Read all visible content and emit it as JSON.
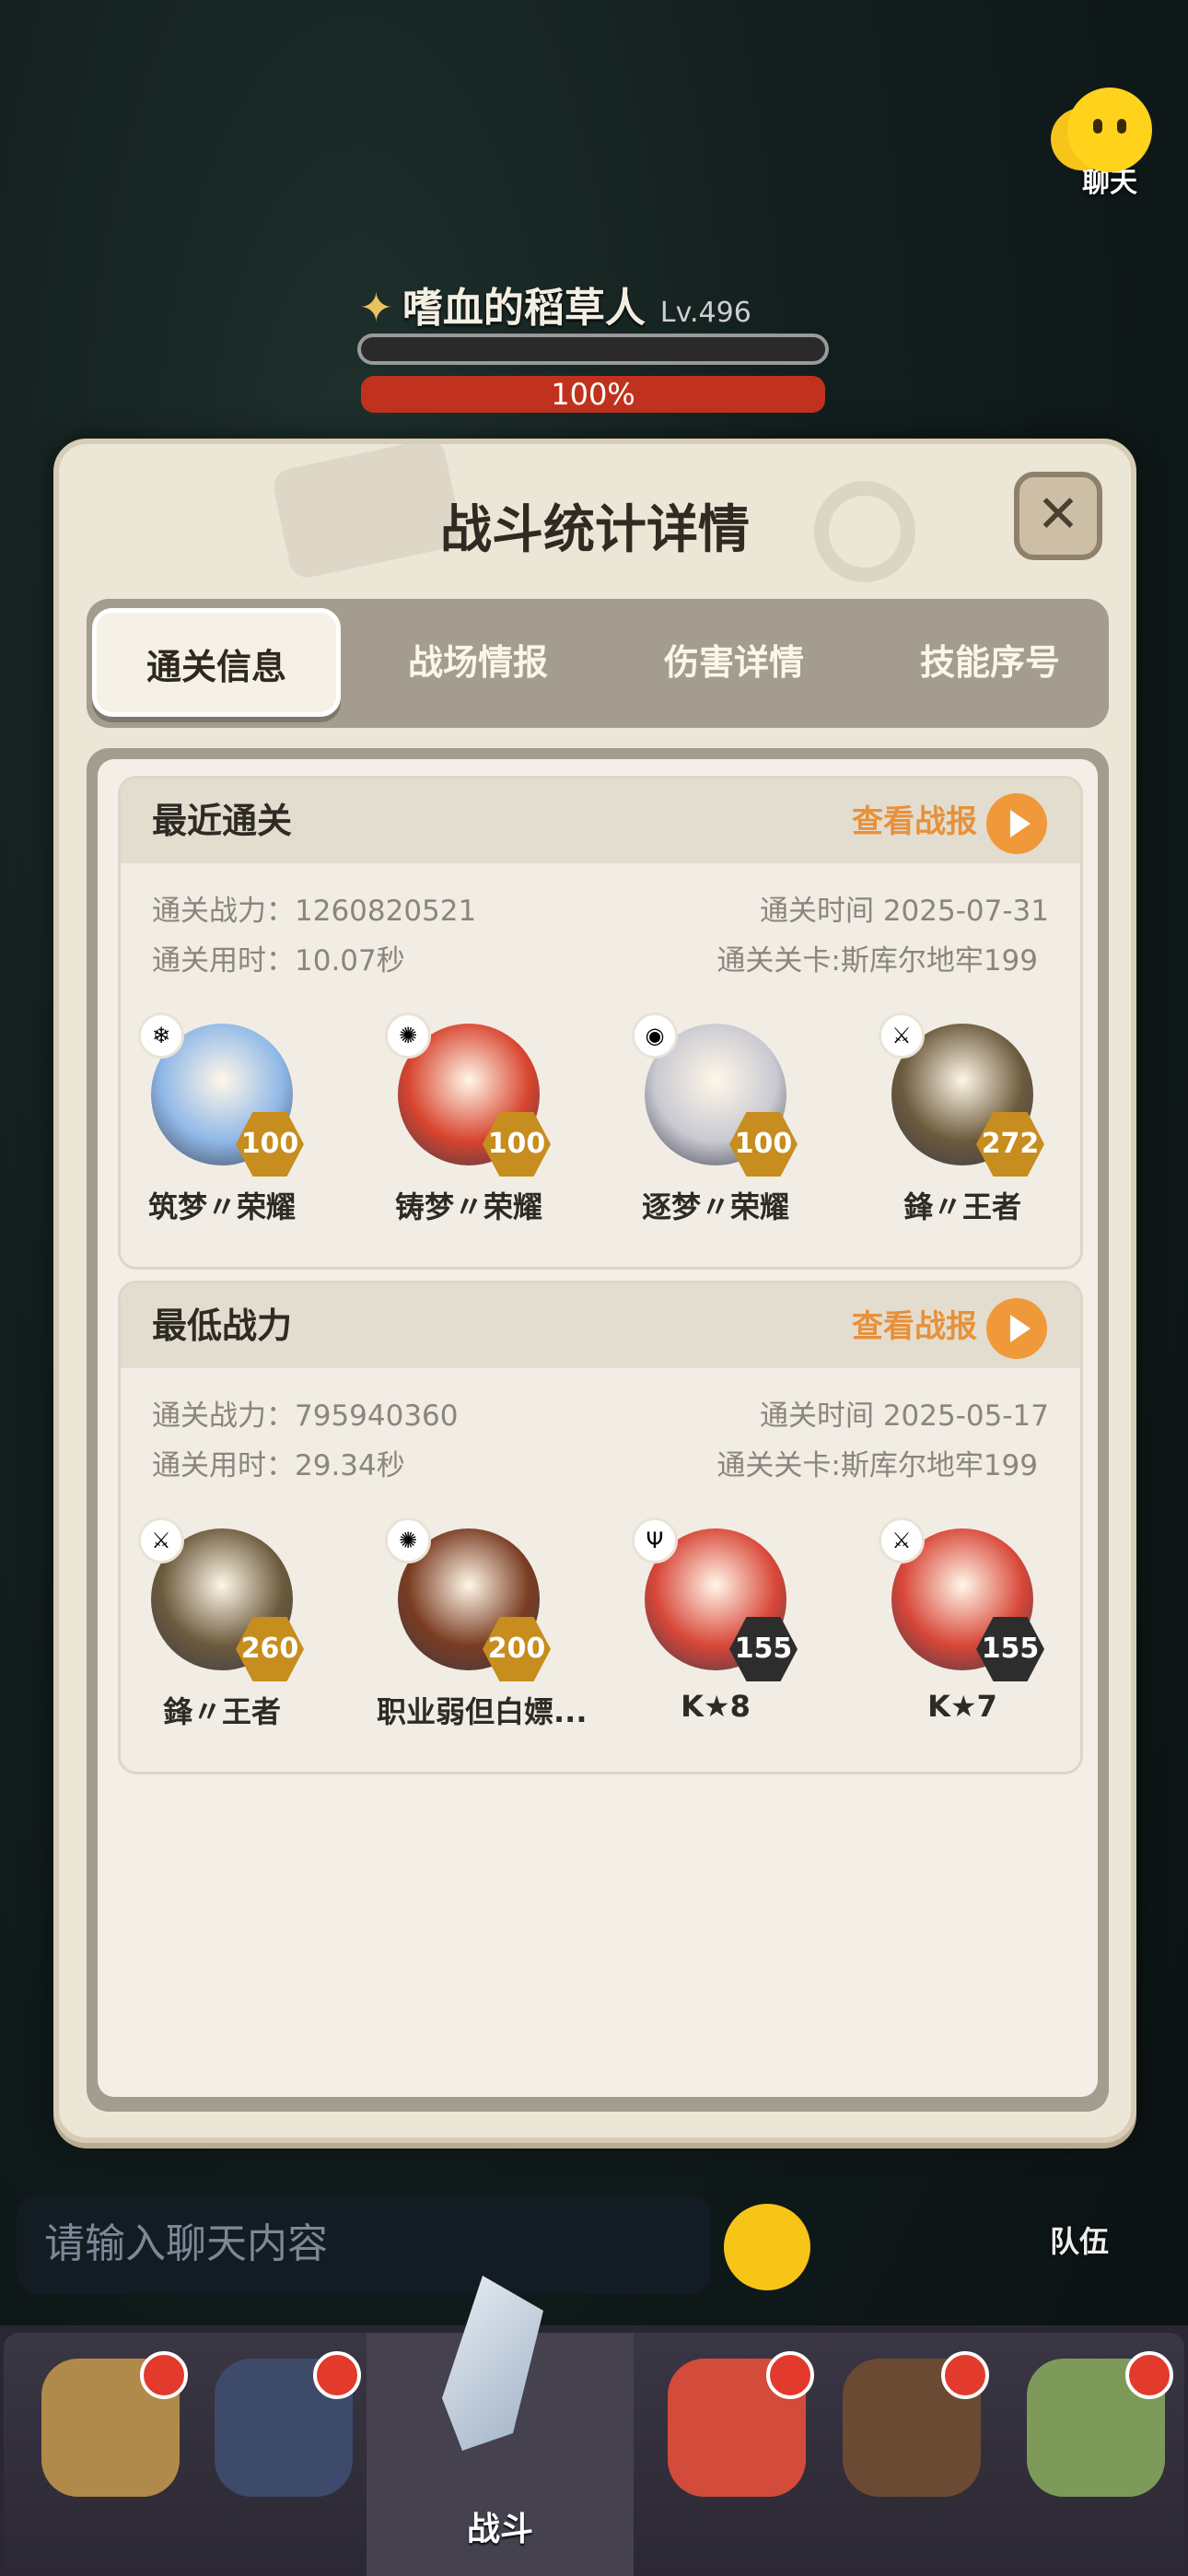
{
  "hud": {
    "chat_label": "聊天",
    "boss_name": "嗜血的稻草人",
    "boss_level": "Lv.496",
    "boss_hp_percent": "100%"
  },
  "modal": {
    "title": "战斗统计详情",
    "close_glyph": "✕",
    "tabs": [
      {
        "label": "通关信息",
        "active": true
      },
      {
        "label": "战场情报",
        "active": false
      },
      {
        "label": "伤害详情",
        "active": false
      },
      {
        "label": "技能序号",
        "active": false
      }
    ]
  },
  "recent": {
    "title": "最近通关",
    "view_label": "查看战报",
    "power": "通关战力：1260820521",
    "time": "通关时间  2025-07-31",
    "duration": "通关用时：10.07秒",
    "stage": "通关关卡:斯库尔地牢199",
    "heroes": [
      {
        "name": "筑梦〃荣耀",
        "level": "100",
        "element": "ice-icon",
        "color": "#8fb8e8"
      },
      {
        "name": "铸梦〃荣耀",
        "level": "100",
        "element": "fire-icon",
        "color": "#d8442e"
      },
      {
        "name": "逐梦〃荣耀",
        "level": "100",
        "element": "arcane-icon",
        "color": "#c9c9d2"
      },
      {
        "name": "鋒〃王者",
        "level": "272",
        "element": "blade-icon",
        "color": "#6c5a3c"
      }
    ]
  },
  "lowest": {
    "title": "最低战力",
    "view_label": "查看战报",
    "power": "通关战力：795940360",
    "time": "通关时间  2025-05-17",
    "duration": "通关用时：29.34秒",
    "stage": "通关关卡:斯库尔地牢199",
    "heroes": [
      {
        "name": "鋒〃王者",
        "level": "260",
        "element": "blade-icon",
        "color": "#6c5a3c"
      },
      {
        "name": "职业弱但白嫖...",
        "level": "200",
        "element": "fire-icon",
        "color": "#7a3c22"
      },
      {
        "name": "K★8",
        "level": "155",
        "element": "trident-icon",
        "color": "#d84638"
      },
      {
        "name": "K★7",
        "level": "155",
        "element": "blade-icon",
        "color": "#d84638"
      }
    ]
  },
  "chat": {
    "placeholder": "请输入聊天内容",
    "team_label": "队伍"
  },
  "bottom_nav": {
    "battle_label": "战斗"
  }
}
